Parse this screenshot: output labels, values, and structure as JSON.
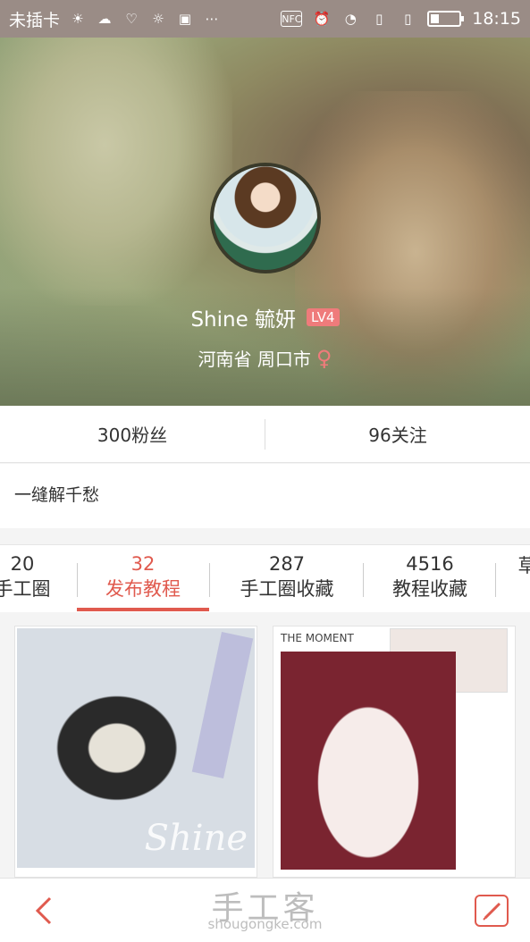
{
  "status_bar": {
    "carrier": "未插卡",
    "time": "18:15",
    "icons": [
      "weather-sun-icon",
      "cloud-icon",
      "shield-icon",
      "weather-icon",
      "app-icon",
      "more-dots-icon",
      "nfc-icon",
      "alarm-icon",
      "wifi-icon",
      "sim-icon",
      "sim2-icon",
      "battery-icon"
    ],
    "battery_level": 0.3
  },
  "profile": {
    "name": "Shine  毓妍",
    "level": "LV4",
    "location": "河南省 周口市",
    "gender_symbol": "♀"
  },
  "stats": {
    "fans": "300粉丝",
    "following": "96关注"
  },
  "bio": "一缝解千愁",
  "tabs": [
    {
      "num": "20",
      "label": "手工圈"
    },
    {
      "num": "32",
      "label": "发布教程",
      "active": true
    },
    {
      "num": "287",
      "label": "手工圈收藏"
    },
    {
      "num": "4516",
      "label": "教程收藏"
    },
    {
      "num": "",
      "label": "草"
    }
  ],
  "cards": [
    {
      "watermark": "Shine"
    },
    {
      "caption": "THE MOMENT"
    }
  ],
  "bottom_bar": {
    "brand": "手工客",
    "domain": "shougongke.com"
  },
  "colors": {
    "accent": "#e05a4e",
    "status_bar": "#9a8c86"
  }
}
